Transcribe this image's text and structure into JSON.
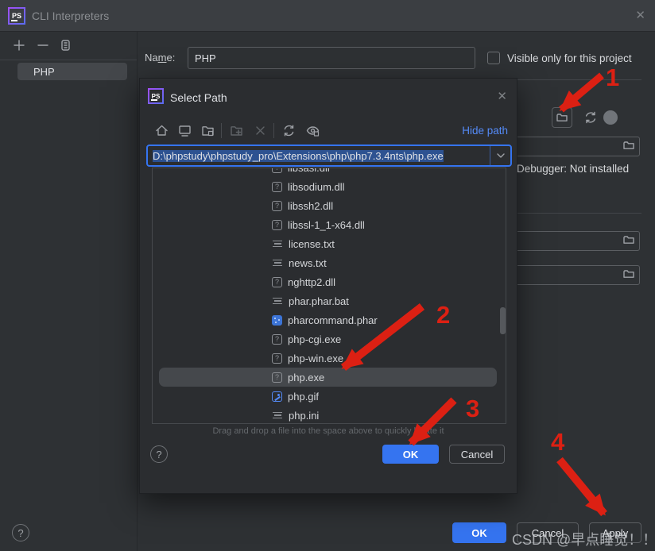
{
  "window": {
    "app_badge": "PS",
    "title": "CLI Interpreters",
    "close_glyph": "✕"
  },
  "sidebar": {
    "selected_item": "PHP"
  },
  "main": {
    "name_label_pre": "Na",
    "name_label_mnemonic": "m",
    "name_label_post": "e:",
    "name_value": "PHP",
    "visible_checkbox_label": "Visible only for this project",
    "debugger_status": "Debugger: Not installed",
    "ok_label": "OK",
    "cancel_label": "Cancel",
    "apply_label": "Apply",
    "help_glyph": "?"
  },
  "dialog": {
    "app_badge": "PS",
    "title": "Select Path",
    "close_glyph": "✕",
    "hide_path_label": "Hide path",
    "path_value": "D:\\phpstudy\\phpstudy_pro\\Extensions\\php\\php7.3.4nts\\php.exe",
    "files": [
      {
        "name": "libsasl.dll",
        "icon": "unknown-file-icon",
        "selected": false
      },
      {
        "name": "libsodium.dll",
        "icon": "unknown-file-icon",
        "selected": false
      },
      {
        "name": "libssh2.dll",
        "icon": "unknown-file-icon",
        "selected": false
      },
      {
        "name": "libssl-1_1-x64.dll",
        "icon": "unknown-file-icon",
        "selected": false
      },
      {
        "name": "license.txt",
        "icon": "text-file-icon",
        "selected": false
      },
      {
        "name": "news.txt",
        "icon": "text-file-icon",
        "selected": false
      },
      {
        "name": "nghttp2.dll",
        "icon": "unknown-file-icon",
        "selected": false
      },
      {
        "name": "phar.phar.bat",
        "icon": "text-file-icon",
        "selected": false
      },
      {
        "name": "pharcommand.phar",
        "icon": "archive-file-icon",
        "selected": false
      },
      {
        "name": "php-cgi.exe",
        "icon": "unknown-file-icon",
        "selected": false
      },
      {
        "name": "php-win.exe",
        "icon": "unknown-file-icon",
        "selected": false
      },
      {
        "name": "php.exe",
        "icon": "unknown-file-icon",
        "selected": true
      },
      {
        "name": "php.gif",
        "icon": "image-file-icon",
        "selected": false
      },
      {
        "name": "php.ini",
        "icon": "text-file-icon",
        "selected": false
      }
    ],
    "hint": "Drag and drop a file into the space above to quickly locate it",
    "help_glyph": "?",
    "ok_label": "OK",
    "cancel_label": "Cancel"
  },
  "annotations": {
    "steps": [
      "1",
      "2",
      "3",
      "4"
    ],
    "arrow_color": "#dc2013"
  },
  "watermark": "CSDN @早点睡觉！！！",
  "colors": {
    "accent_blue": "#3574f0",
    "link_blue": "#548af7",
    "selection_blue": "#2d5291",
    "annotation_red": "#dc2013",
    "titlebar": "#3b3e42",
    "window_bg": "#2e3134",
    "dialog_bg": "#2b2d30"
  }
}
